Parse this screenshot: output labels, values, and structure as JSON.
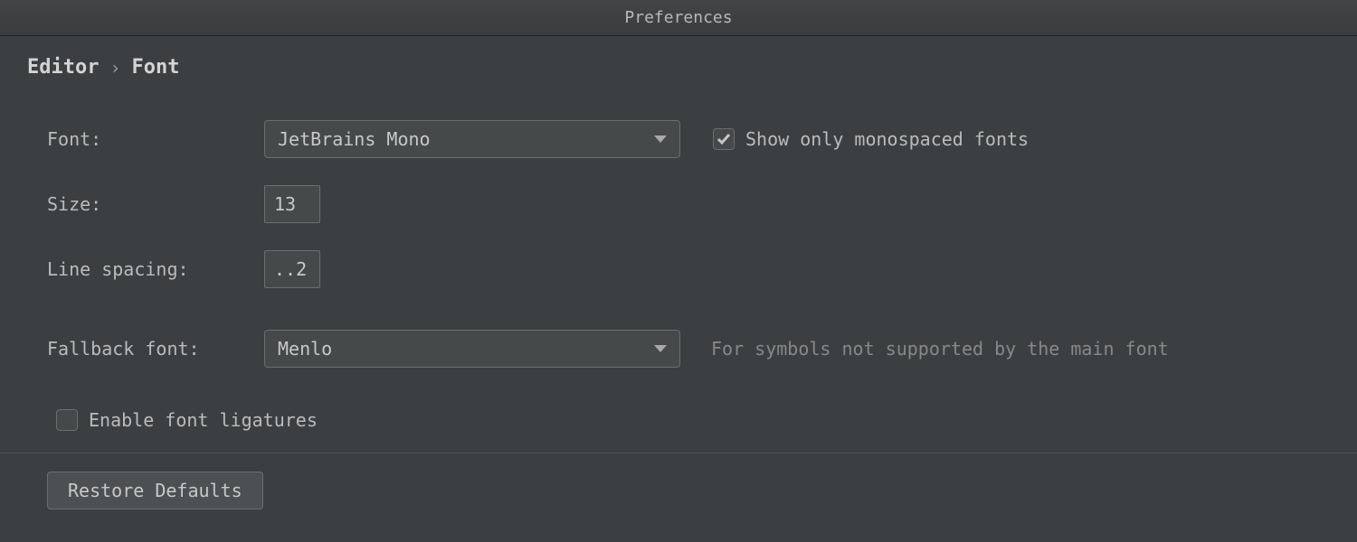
{
  "window": {
    "title": "Preferences"
  },
  "breadcrumb": {
    "parent": "Editor",
    "current": "Font"
  },
  "labels": {
    "font": "Font:",
    "size": "Size:",
    "line_spacing": "Line spacing:",
    "fallback_font": "Fallback font:"
  },
  "values": {
    "font": "JetBrains Mono",
    "size": "13",
    "line_spacing": "..2",
    "fallback_font": "Menlo"
  },
  "checkboxes": {
    "monospaced_only": {
      "label": "Show only monospaced fonts",
      "checked": true
    },
    "ligatures": {
      "label": "Enable font ligatures",
      "checked": false
    }
  },
  "hints": {
    "fallback": "For symbols not supported by the main font"
  },
  "buttons": {
    "restore_defaults": "Restore Defaults"
  }
}
